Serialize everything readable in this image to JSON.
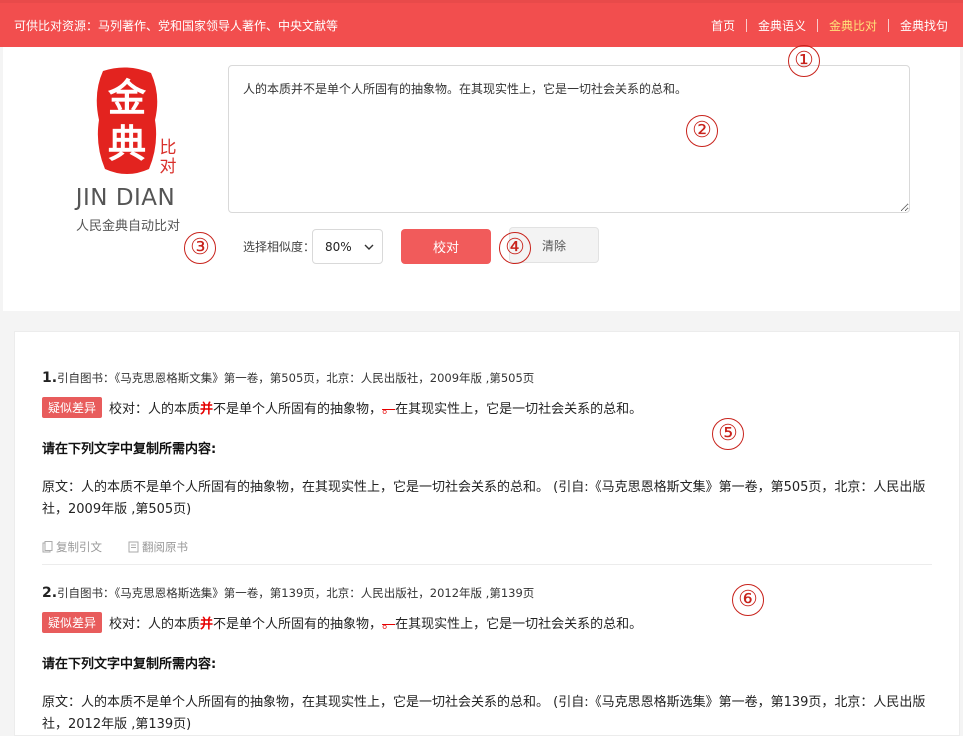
{
  "topbar": {
    "resources": "可供比对资源：马列著作、党和国家领导人著作、中央文献等",
    "nav": [
      {
        "label": "首页",
        "active": false
      },
      {
        "label": "金典语义",
        "active": false
      },
      {
        "label": "金典比对",
        "active": true
      },
      {
        "label": "金典找句",
        "active": false
      }
    ]
  },
  "logo": {
    "seal_chars": [
      "金",
      "典"
    ],
    "sub_chars": "比对",
    "latin": "JIN DIAN",
    "cn": "人民金典自动比对"
  },
  "input": {
    "value": "人的本质并不是单个人所固有的抽象物。在其现实性上，它是一切社会关系的总和。"
  },
  "controls": {
    "similarity_label": "选择相似度：",
    "similarity_value": "80%",
    "check_label": "校对",
    "clear_label": "清除"
  },
  "markers": [
    "①",
    "②",
    "③",
    "④",
    "⑤",
    "⑥"
  ],
  "results": [
    {
      "num": "1.",
      "source": "引自图书：《马克思恩格斯文集》第一卷，第505页，北京：人民出版社，2009年版 ,第505页",
      "badge": "疑似差异",
      "check_prefix": "校对：人的本质",
      "check_hl": "并",
      "check_mid": "不是单个人所固有的抽象物，",
      "check_mark": "。",
      "check_suffix": "在其现实性上，它是一切社会关系的总和。",
      "copy_title": "请在下列文字中复制所需内容:",
      "original": "原文：人的本质不是单个人所固有的抽象物，在其现实性上，它是一切社会关系的总和。 (引自:《马克思恩格斯文集》第一卷，第505页，北京：人民出版社，2009年版 ,第505页)",
      "copy_action": "复制引文",
      "read_action": "翻阅原书"
    },
    {
      "num": "2.",
      "source": "引自图书：《马克思恩格斯选集》第一卷，第139页，北京：人民出版社，2012年版 ,第139页",
      "badge": "疑似差异",
      "check_prefix": "校对：人的本质",
      "check_hl": "并",
      "check_mid": "不是单个人所固有的抽象物，",
      "check_mark": "。",
      "check_suffix": "在其现实性上，它是一切社会关系的总和。",
      "copy_title": "请在下列文字中复制所需内容:",
      "original": "原文：人的本质不是单个人所固有的抽象物，在其现实性上，它是一切社会关系的总和。 (引自:《马克思恩格斯选集》第一卷，第139页，北京：人民出版社，2012年版 ,第139页)"
    }
  ],
  "colors": {
    "brand": "#f24e4e",
    "active_nav": "#ffe27a",
    "badge": "#e85c5c",
    "highlight": "#e60000",
    "marker": "#c8231c"
  }
}
